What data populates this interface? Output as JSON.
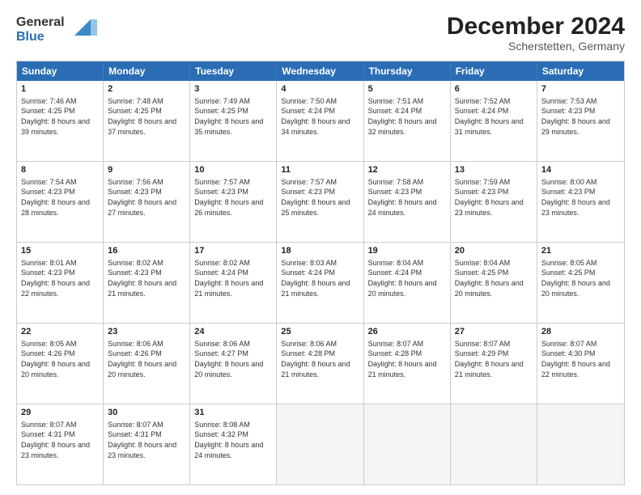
{
  "header": {
    "logo_line1": "General",
    "logo_line2": "Blue",
    "month_year": "December 2024",
    "location": "Scherstetten, Germany"
  },
  "weekdays": [
    "Sunday",
    "Monday",
    "Tuesday",
    "Wednesday",
    "Thursday",
    "Friday",
    "Saturday"
  ],
  "weeks": [
    [
      {
        "day": "1",
        "sunrise": "7:46 AM",
        "sunset": "4:25 PM",
        "daylight": "8 hours and 39 minutes."
      },
      {
        "day": "2",
        "sunrise": "7:48 AM",
        "sunset": "4:25 PM",
        "daylight": "8 hours and 37 minutes."
      },
      {
        "day": "3",
        "sunrise": "7:49 AM",
        "sunset": "4:25 PM",
        "daylight": "8 hours and 35 minutes."
      },
      {
        "day": "4",
        "sunrise": "7:50 AM",
        "sunset": "4:24 PM",
        "daylight": "8 hours and 34 minutes."
      },
      {
        "day": "5",
        "sunrise": "7:51 AM",
        "sunset": "4:24 PM",
        "daylight": "8 hours and 32 minutes."
      },
      {
        "day": "6",
        "sunrise": "7:52 AM",
        "sunset": "4:24 PM",
        "daylight": "8 hours and 31 minutes."
      },
      {
        "day": "7",
        "sunrise": "7:53 AM",
        "sunset": "4:23 PM",
        "daylight": "8 hours and 29 minutes."
      }
    ],
    [
      {
        "day": "8",
        "sunrise": "7:54 AM",
        "sunset": "4:23 PM",
        "daylight": "8 hours and 28 minutes."
      },
      {
        "day": "9",
        "sunrise": "7:56 AM",
        "sunset": "4:23 PM",
        "daylight": "8 hours and 27 minutes."
      },
      {
        "day": "10",
        "sunrise": "7:57 AM",
        "sunset": "4:23 PM",
        "daylight": "8 hours and 26 minutes."
      },
      {
        "day": "11",
        "sunrise": "7:57 AM",
        "sunset": "4:23 PM",
        "daylight": "8 hours and 25 minutes."
      },
      {
        "day": "12",
        "sunrise": "7:58 AM",
        "sunset": "4:23 PM",
        "daylight": "8 hours and 24 minutes."
      },
      {
        "day": "13",
        "sunrise": "7:59 AM",
        "sunset": "4:23 PM",
        "daylight": "8 hours and 23 minutes."
      },
      {
        "day": "14",
        "sunrise": "8:00 AM",
        "sunset": "4:23 PM",
        "daylight": "8 hours and 23 minutes."
      }
    ],
    [
      {
        "day": "15",
        "sunrise": "8:01 AM",
        "sunset": "4:23 PM",
        "daylight": "8 hours and 22 minutes."
      },
      {
        "day": "16",
        "sunrise": "8:02 AM",
        "sunset": "4:23 PM",
        "daylight": "8 hours and 21 minutes."
      },
      {
        "day": "17",
        "sunrise": "8:02 AM",
        "sunset": "4:24 PM",
        "daylight": "8 hours and 21 minutes."
      },
      {
        "day": "18",
        "sunrise": "8:03 AM",
        "sunset": "4:24 PM",
        "daylight": "8 hours and 21 minutes."
      },
      {
        "day": "19",
        "sunrise": "8:04 AM",
        "sunset": "4:24 PM",
        "daylight": "8 hours and 20 minutes."
      },
      {
        "day": "20",
        "sunrise": "8:04 AM",
        "sunset": "4:25 PM",
        "daylight": "8 hours and 20 minutes."
      },
      {
        "day": "21",
        "sunrise": "8:05 AM",
        "sunset": "4:25 PM",
        "daylight": "8 hours and 20 minutes."
      }
    ],
    [
      {
        "day": "22",
        "sunrise": "8:05 AM",
        "sunset": "4:26 PM",
        "daylight": "8 hours and 20 minutes."
      },
      {
        "day": "23",
        "sunrise": "8:06 AM",
        "sunset": "4:26 PM",
        "daylight": "8 hours and 20 minutes."
      },
      {
        "day": "24",
        "sunrise": "8:06 AM",
        "sunset": "4:27 PM",
        "daylight": "8 hours and 20 minutes."
      },
      {
        "day": "25",
        "sunrise": "8:06 AM",
        "sunset": "4:28 PM",
        "daylight": "8 hours and 21 minutes."
      },
      {
        "day": "26",
        "sunrise": "8:07 AM",
        "sunset": "4:28 PM",
        "daylight": "8 hours and 21 minutes."
      },
      {
        "day": "27",
        "sunrise": "8:07 AM",
        "sunset": "4:29 PM",
        "daylight": "8 hours and 21 minutes."
      },
      {
        "day": "28",
        "sunrise": "8:07 AM",
        "sunset": "4:30 PM",
        "daylight": "8 hours and 22 minutes."
      }
    ],
    [
      {
        "day": "29",
        "sunrise": "8:07 AM",
        "sunset": "4:31 PM",
        "daylight": "8 hours and 23 minutes."
      },
      {
        "day": "30",
        "sunrise": "8:07 AM",
        "sunset": "4:31 PM",
        "daylight": "8 hours and 23 minutes."
      },
      {
        "day": "31",
        "sunrise": "8:08 AM",
        "sunset": "4:32 PM",
        "daylight": "8 hours and 24 minutes."
      },
      null,
      null,
      null,
      null
    ]
  ]
}
